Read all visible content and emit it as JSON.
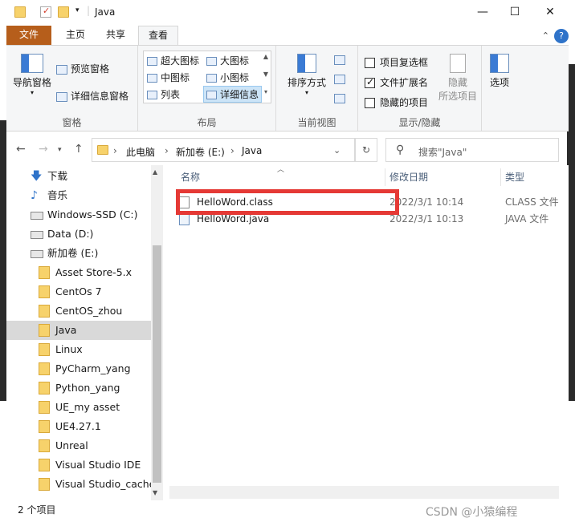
{
  "window": {
    "title": "Java"
  },
  "tabs": [
    "文件",
    "主页",
    "共享",
    "查看"
  ],
  "ribbon": {
    "panes": {
      "nav_pane": "导航窗格",
      "preview_pane": "预览窗格",
      "details_pane": "详细信息窗格",
      "group": "窗格"
    },
    "layout": {
      "items": [
        "超大图标",
        "大图标",
        "中图标",
        "小图标",
        "列表",
        "详细信息"
      ],
      "selected": "详细信息",
      "group": "布局"
    },
    "current_view": {
      "sort_by": "排序方式",
      "group": "当前视图"
    },
    "show_hide": {
      "checkboxes": [
        {
          "label": "项目复选框",
          "checked": false
        },
        {
          "label": "文件扩展名",
          "checked": true
        },
        {
          "label": "隐藏的项目",
          "checked": false
        }
      ],
      "hide_selected": "隐藏\n所选项目",
      "hide_selected_l1": "隐藏",
      "hide_selected_l2": "所选项目",
      "group": "显示/隐藏"
    },
    "options": "选项"
  },
  "address": {
    "crumbs": [
      "此电脑",
      "新加卷 (E:)",
      "Java"
    ],
    "search_placeholder": "搜索\"Java\""
  },
  "sidebar": {
    "items": [
      {
        "label": "下载",
        "icon": "download-icon"
      },
      {
        "label": "音乐",
        "icon": "music-icon"
      },
      {
        "label": "Windows-SSD (C:)",
        "icon": "drive-icon"
      },
      {
        "label": "Data (D:)",
        "icon": "drive-icon"
      },
      {
        "label": "新加卷 (E:)",
        "icon": "drive-icon"
      },
      {
        "label": "Asset Store-5.x",
        "icon": "folder-icon"
      },
      {
        "label": "CentOs 7",
        "icon": "folder-icon"
      },
      {
        "label": "CentOS_zhou",
        "icon": "folder-icon"
      },
      {
        "label": "Java",
        "icon": "folder-icon",
        "selected": true
      },
      {
        "label": "Linux",
        "icon": "folder-icon"
      },
      {
        "label": "PyCharm_yang",
        "icon": "folder-icon"
      },
      {
        "label": "Python_yang",
        "icon": "folder-icon"
      },
      {
        "label": "UE_my asset",
        "icon": "folder-icon"
      },
      {
        "label": "UE4.27.1",
        "icon": "folder-icon"
      },
      {
        "label": "Unreal",
        "icon": "folder-icon"
      },
      {
        "label": "Visual Studio IDE",
        "icon": "folder-icon"
      },
      {
        "label": "Visual Studio_cache",
        "icon": "folder-icon"
      }
    ]
  },
  "filelist": {
    "columns": [
      "名称",
      "修改日期",
      "类型"
    ],
    "rows": [
      {
        "name": "HelloWord.class",
        "modified": "2022/3/1 10:14",
        "type": "CLASS 文件"
      },
      {
        "name": "HelloWord.java",
        "modified": "2022/3/1 10:13",
        "type": "JAVA 文件"
      }
    ]
  },
  "status": {
    "count": "2 个项目"
  },
  "watermark": "CSDN @小猿编程",
  "colors": {
    "file_tab": "#b65e1b",
    "highlight": "#e53935",
    "folder": "#f7d26b"
  }
}
